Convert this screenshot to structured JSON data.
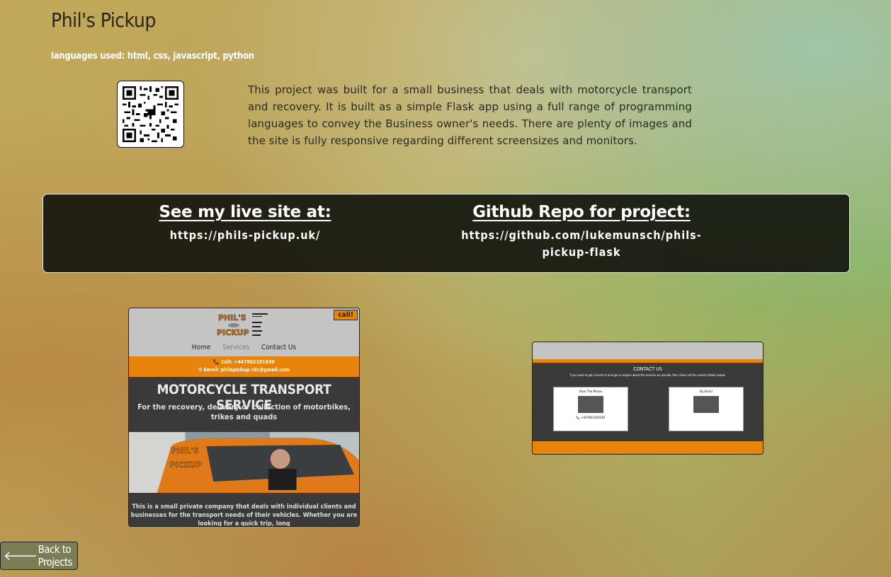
{
  "project": {
    "title": "Phil's Pickup",
    "languages": "languages used: html, css, javascript, python",
    "description": "This project was built for a small business that deals with motorcycle transport and recovery. It is built as a simple Flask app using a full range of programming languages to convey the Business owner's needs. There are plenty of images and the site is fully responsive regarding different screensizes and monitors."
  },
  "links": {
    "live_heading": "See my live site at:",
    "live_url": "https://phils-pickup.uk/",
    "repo_heading": "Github Repo for project:",
    "repo_url": "https://github.com/lukemunsch/phils-pickup-flask"
  },
  "screenshot1": {
    "call": "call!",
    "nav": [
      "Home",
      "Services",
      "Contact Us"
    ],
    "phone": "📞 Call: +447802181630",
    "email": "✉ Email: philspickup.rdc@gmail.com",
    "hero_title": "MOTORCYCLE TRANSPORT SERVICE",
    "hero_sub": "For the recovery, delivery or collection of motorbikes, trikes and quads",
    "body": "This is a small private company that deals with individual clients and businesses for the transport needs of their vehicles. Whether you are looking for a quick trip, long"
  },
  "screenshot2": {
    "title": "CONTACT US",
    "sub": "If you want to get in touch to arrange or enquire about the services we provide, then check out the contact details below!",
    "card1": "Over The Phone",
    "card2": "By Email",
    "phone": "📞 +447802181630"
  },
  "back_button": {
    "label": "Back to Projects",
    "icon": "arrow-left-icon"
  }
}
